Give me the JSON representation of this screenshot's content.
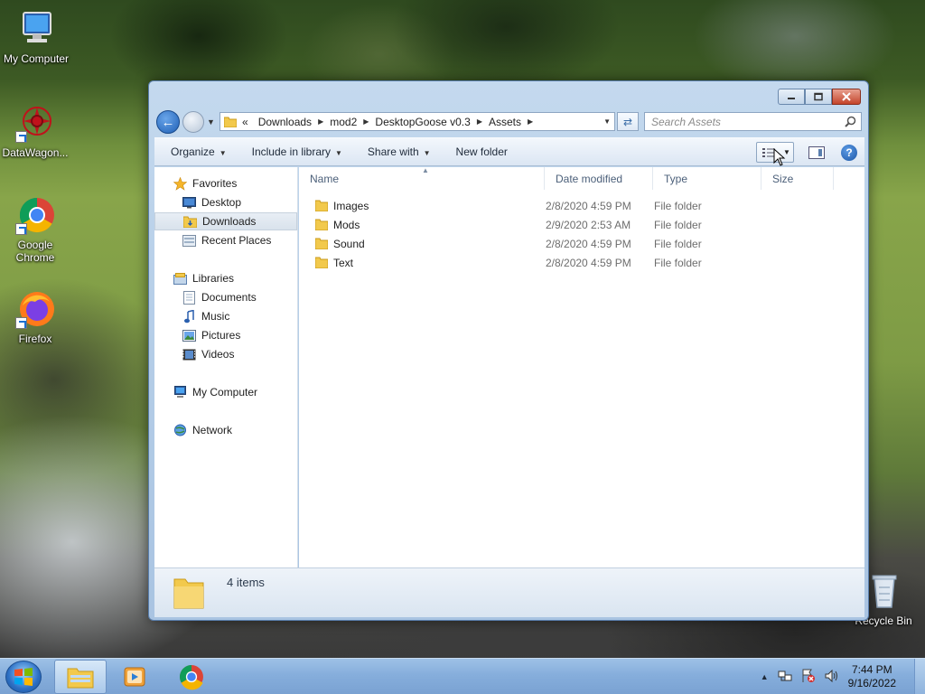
{
  "desktop": {
    "icons": [
      {
        "label": "My Computer"
      },
      {
        "label": "DataWagon..."
      },
      {
        "label": "Google Chrome"
      },
      {
        "label": "Firefox"
      },
      {
        "label": "Recycle Bin"
      }
    ]
  },
  "address": {
    "chevron": "«",
    "crumbs": [
      "Downloads",
      "mod2",
      "DesktopGoose v0.3",
      "Assets"
    ]
  },
  "search": {
    "placeholder": "Search Assets"
  },
  "toolbar": {
    "organize": "Organize",
    "include_in_library": "Include in library",
    "share_with": "Share with",
    "new_folder": "New folder"
  },
  "nav": {
    "favorites": "Favorites",
    "desktop": "Desktop",
    "downloads": "Downloads",
    "recent_places": "Recent Places",
    "libraries": "Libraries",
    "documents": "Documents",
    "music": "Music",
    "pictures": "Pictures",
    "videos": "Videos",
    "my_computer": "My Computer",
    "network": "Network"
  },
  "columns": {
    "name": "Name",
    "date": "Date modified",
    "type": "Type",
    "size": "Size"
  },
  "files": [
    {
      "name": "Images",
      "date": "2/8/2020 4:59 PM",
      "type": "File folder"
    },
    {
      "name": "Mods",
      "date": "2/9/2020 2:53 AM",
      "type": "File folder"
    },
    {
      "name": "Sound",
      "date": "2/8/2020 4:59 PM",
      "type": "File folder"
    },
    {
      "name": "Text",
      "date": "2/8/2020 4:59 PM",
      "type": "File folder"
    }
  ],
  "status": {
    "item_count": "4 items"
  },
  "clock": {
    "time": "7:44 PM",
    "date": "9/16/2022"
  },
  "colors": {
    "selection": "#d9e2ec",
    "window_frame": "#b7cfe8",
    "taskbar": "#86aedc"
  }
}
